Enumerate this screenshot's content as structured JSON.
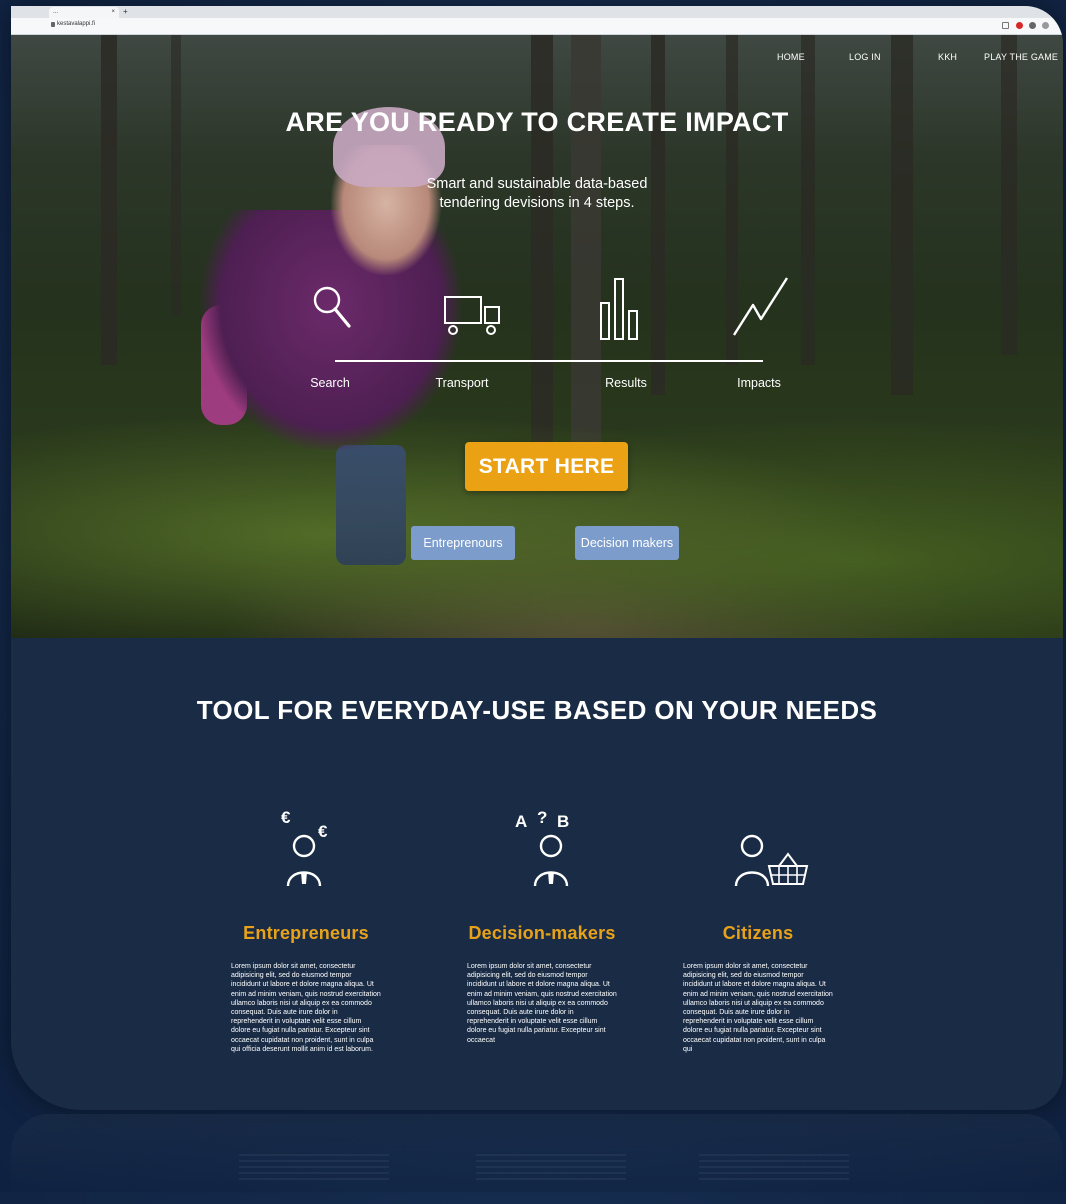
{
  "browser": {
    "tab_title": "...",
    "tab_close": "×",
    "new_tab": "+",
    "url": "kestavalappi.fi"
  },
  "nav": {
    "home": "HOME",
    "login": "LOG IN",
    "kkh": "KKH",
    "play": "PLAY THE GAME"
  },
  "hero": {
    "title": "ARE YOU READY TO CREATE IMPACT",
    "subtitle_line1": "Smart and sustainable data-based",
    "subtitle_line2": "tendering devisions in 4 steps.",
    "steps": [
      {
        "label": "Search",
        "icon": "magnifier-icon"
      },
      {
        "label": "Transport",
        "icon": "truck-icon"
      },
      {
        "label": "Results",
        "icon": "bar-chart-icon"
      },
      {
        "label": "Impacts",
        "icon": "trend-line-icon"
      }
    ],
    "start_button": "START HERE",
    "entrepreneurs_button": "Entreprenours",
    "decision_makers_button": "Decision makers"
  },
  "section": {
    "title": "TOOL FOR EVERYDAY-USE BASED ON YOUR NEEDS",
    "columns": [
      {
        "title": "Entrepreneurs",
        "icon": "person-euro-icon",
        "glyph_a": "€",
        "glyph_b": "€",
        "body": "Lorem ipsum dolor sit amet, consectetur adipisicing elit, sed do eiusmod tempor incididunt ut labore et dolore magna aliqua. Ut enim ad minim veniam, quis nostrud exercitation ullamco laboris nisi ut aliquip ex ea commodo consequat. Duis aute irure dolor in reprehenderit in voluptate velit esse cillum dolore eu fugiat nulla pariatur. Excepteur sint occaecat cupidatat non proident, sunt in culpa qui officia deserunt mollit anim id est laborum."
      },
      {
        "title": "Decision-makers",
        "icon": "person-choice-icon",
        "glyph_a": "A",
        "glyph_q": "?",
        "glyph_b": "B",
        "body": "Lorem ipsum dolor sit amet, consectetur adipisicing elit, sed do eiusmod tempor incididunt ut labore et dolore magna aliqua. Ut enim ad minim veniam, quis nostrud exercitation ullamco laboris nisi ut aliquip ex ea commodo consequat. Duis aute irure dolor in reprehenderit in voluptate velit esse cillum dolore eu fugiat nulla pariatur. Excepteur sint occaecat"
      },
      {
        "title": "Citizens",
        "icon": "person-basket-icon",
        "body": "Lorem ipsum dolor sit amet, consectetur adipisicing elit, sed do eiusmod tempor incididunt ut labore et dolore magna aliqua. Ut enim ad minim veniam, quis nostrud exercitation ullamco laboris nisi ut aliquip ex ea commodo consequat. Duis aute irure dolor in reprehenderit in voluptate velit esse cillum dolore eu fugiat nulla pariatur. Excepteur sint occaecat cupidatat non proident, sunt in culpa qui"
      }
    ]
  },
  "colors": {
    "accent_orange": "#eba114",
    "secondary_button": "#7c9ccb",
    "section_bg": "#1a2c45",
    "heading_orange": "#e8a21a"
  }
}
